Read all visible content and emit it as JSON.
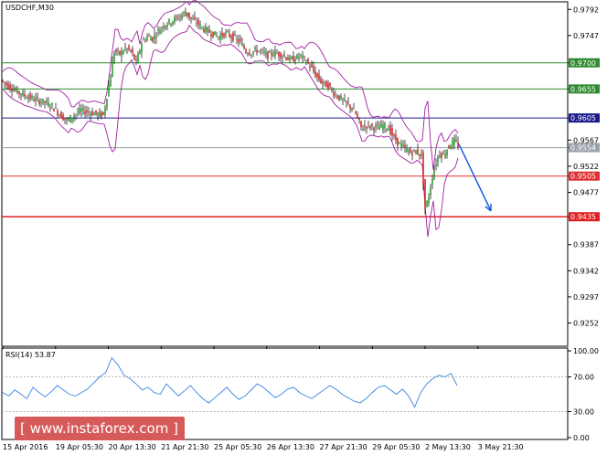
{
  "chart_data": [
    {
      "type": "candlestick",
      "title": "USDCHF,M30",
      "ylim": [
        0.9212,
        0.9805
      ],
      "y_ticks": [
        "0.9792",
        "0.9747",
        "0.9700",
        "0.9655",
        "0.9605",
        "0.9567",
        "0.9554",
        "0.9522",
        "0.9505",
        "0.9477",
        "0.9435",
        "0.9387",
        "0.9342",
        "0.9297",
        "0.9252"
      ],
      "x_ticks": [
        "15 Apr 2016",
        "19 Apr 05:30",
        "20 Apr 13:30",
        "21 Apr 21:30",
        "25 Apr 05:30",
        "26 Apr 13:30",
        "27 Apr 21:30",
        "29 Apr 05:30",
        "2 May 13:30",
        "3 May 21:30"
      ],
      "levels": [
        {
          "label": "0.9700",
          "value": 0.97,
          "color": "#2e8b2e",
          "kind": "resistance"
        },
        {
          "label": "0.9655",
          "value": 0.9655,
          "color": "#2e8b2e",
          "kind": "resistance"
        },
        {
          "label": "0.9605",
          "value": 0.9605,
          "color": "#1b1b8c",
          "kind": "pivot"
        },
        {
          "label": "0.9554",
          "value": 0.9554,
          "color": "#9aa0a8",
          "kind": "current"
        },
        {
          "label": "0.9505",
          "value": 0.9505,
          "color": "#e03030",
          "kind": "support"
        },
        {
          "label": "0.9435",
          "value": 0.9435,
          "color": "#e02020",
          "kind": "support"
        }
      ],
      "price_path": [
        [
          0,
          0.967
        ],
        [
          8,
          0.966
        ],
        [
          16,
          0.9652
        ],
        [
          24,
          0.9645
        ],
        [
          32,
          0.964
        ],
        [
          40,
          0.9635
        ],
        [
          48,
          0.9632
        ],
        [
          56,
          0.9625
        ],
        [
          64,
          0.9612
        ],
        [
          72,
          0.96
        ],
        [
          80,
          0.961
        ],
        [
          88,
          0.9618
        ],
        [
          96,
          0.9615
        ],
        [
          104,
          0.9612
        ],
        [
          112,
          0.961
        ],
        [
          118,
          0.966
        ],
        [
          124,
          0.972
        ],
        [
          130,
          0.9715
        ],
        [
          136,
          0.9725
        ],
        [
          142,
          0.972
        ],
        [
          148,
          0.97
        ],
        [
          154,
          0.9735
        ],
        [
          160,
          0.9745
        ],
        [
          166,
          0.9742
        ],
        [
          172,
          0.9755
        ],
        [
          178,
          0.9765
        ],
        [
          184,
          0.977
        ],
        [
          190,
          0.9775
        ],
        [
          196,
          0.978
        ],
        [
          202,
          0.9788
        ],
        [
          208,
          0.9775
        ],
        [
          214,
          0.977
        ],
        [
          220,
          0.976
        ],
        [
          226,
          0.9755
        ],
        [
          232,
          0.975
        ],
        [
          238,
          0.9745
        ],
        [
          244,
          0.975
        ],
        [
          250,
          0.9748
        ],
        [
          256,
          0.9742
        ],
        [
          262,
          0.9735
        ],
        [
          268,
          0.972
        ],
        [
          274,
          0.9718
        ],
        [
          280,
          0.9722
        ],
        [
          286,
          0.9718
        ],
        [
          292,
          0.9712
        ],
        [
          298,
          0.9718
        ],
        [
          304,
          0.9715
        ],
        [
          310,
          0.9712
        ],
        [
          316,
          0.9705
        ],
        [
          322,
          0.9708
        ],
        [
          328,
          0.9712
        ],
        [
          334,
          0.9702
        ],
        [
          340,
          0.969
        ],
        [
          346,
          0.9675
        ],
        [
          352,
          0.9665
        ],
        [
          358,
          0.966
        ],
        [
          364,
          0.9648
        ],
        [
          370,
          0.964
        ],
        [
          376,
          0.9632
        ],
        [
          382,
          0.9625
        ],
        [
          388,
          0.9612
        ],
        [
          394,
          0.9588
        ],
        [
          400,
          0.9592
        ],
        [
          406,
          0.959
        ],
        [
          412,
          0.9588
        ],
        [
          418,
          0.9592
        ],
        [
          424,
          0.9588
        ],
        [
          430,
          0.957
        ],
        [
          436,
          0.956
        ],
        [
          442,
          0.9552
        ],
        [
          448,
          0.9545
        ],
        [
          454,
          0.9548
        ],
        [
          460,
          0.954
        ],
        [
          464,
          0.9448
        ],
        [
          468,
          0.947
        ],
        [
          472,
          0.9505
        ],
        [
          476,
          0.953
        ],
        [
          480,
          0.9545
        ],
        [
          484,
          0.954
        ],
        [
          488,
          0.9552
        ],
        [
          492,
          0.956
        ],
        [
          496,
          0.9565
        ],
        [
          500,
          0.9558
        ]
      ],
      "forecast_arrow": {
        "from": [
          502,
          0.956
        ],
        "to": [
          537,
          0.9445
        ],
        "color": "#1f5fe0"
      }
    },
    {
      "type": "line",
      "title": "RSI(14) 53.87",
      "ylim": [
        0,
        100
      ],
      "y_ticks": [
        "100.00",
        "70.00",
        "30.00",
        "0.00"
      ],
      "reference_lines": [
        70,
        30
      ],
      "series": [
        {
          "values": [
            52,
            48,
            55,
            50,
            45,
            58,
            52,
            47,
            53,
            60,
            55,
            50,
            48,
            52,
            56,
            63,
            70,
            75,
            92,
            84,
            72,
            68,
            62,
            55,
            58,
            52,
            50,
            62,
            55,
            48,
            54,
            60,
            52,
            45,
            40,
            46,
            52,
            58,
            50,
            44,
            48,
            55,
            62,
            58,
            52,
            46,
            50,
            56,
            58,
            52,
            48,
            45,
            50,
            55,
            60,
            56,
            50,
            46,
            42,
            40,
            45,
            52,
            58,
            60,
            55,
            50,
            56,
            48,
            35,
            52,
            62,
            68,
            72,
            70,
            74,
            60
          ],
          "color": "#3a86e0"
        }
      ]
    }
  ],
  "watermark": {
    "text": "[  www.instaforex.com ]",
    "bg": "#d75a5a"
  }
}
